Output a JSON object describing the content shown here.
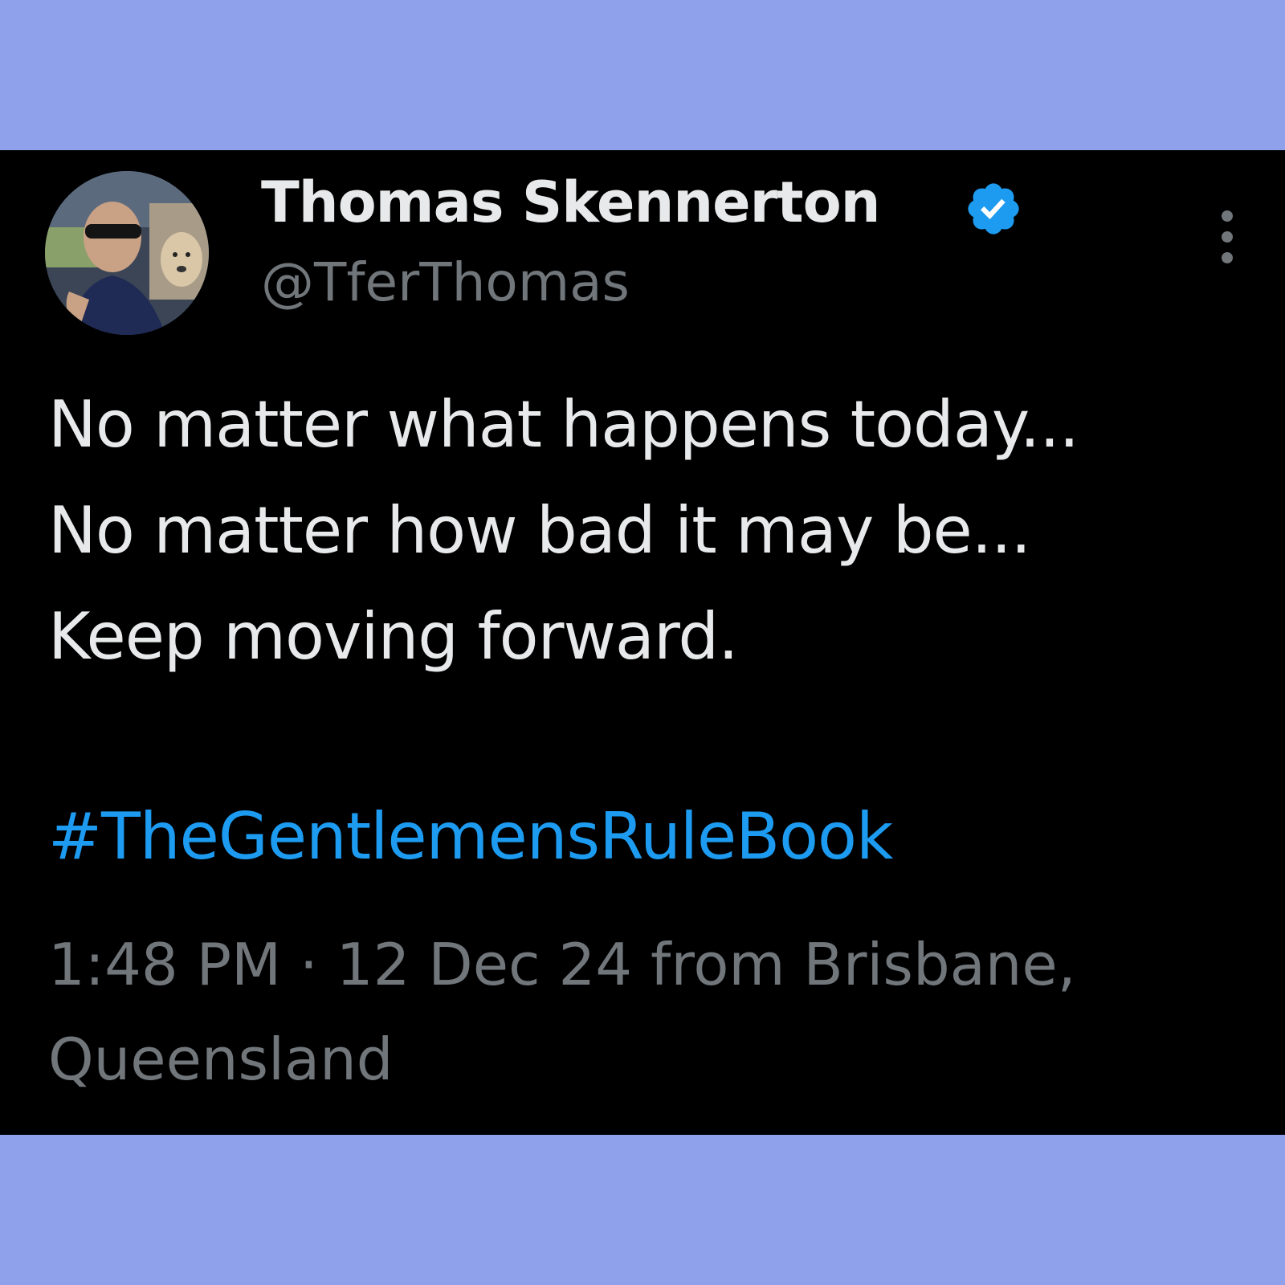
{
  "tweet": {
    "author": {
      "display_name": "Thomas Skennerton",
      "handle": "@TferThomas",
      "verified": true,
      "verified_color": "#1d9bf0"
    },
    "body_lines": [
      "No matter what happens today...",
      "No matter how bad it may be...",
      "Keep moving forward."
    ],
    "hashtag": "#TheGentlemensRuleBook",
    "meta": {
      "line1": "1:48 PM · 12 Dec 24 from Brisbane,",
      "line2": "Queensland"
    }
  },
  "colors": {
    "outer_background": "#8fa1eb",
    "card_background": "#000000",
    "primary_text": "#e7e9ea",
    "secondary_text": "#71767b",
    "link": "#1d9bf0"
  },
  "icons": {
    "verified": "verified-badge-icon",
    "more": "more-options-icon"
  }
}
